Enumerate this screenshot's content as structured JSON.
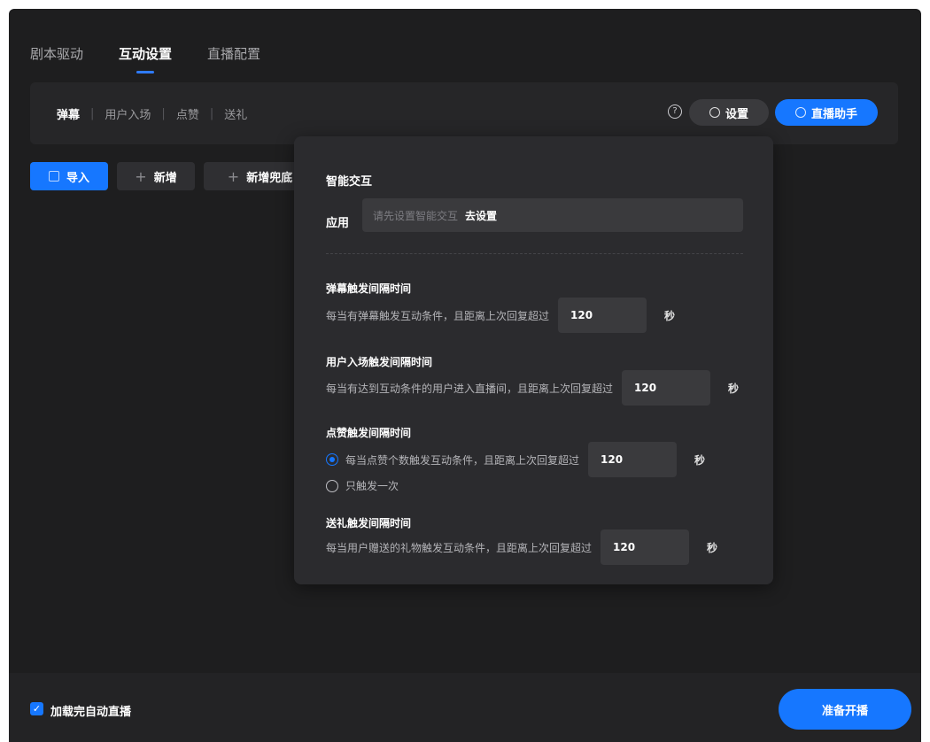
{
  "top_tabs": [
    "剧本驱动",
    "互动设置",
    "直播配置"
  ],
  "sub_tabs": [
    "弹幕",
    "用户入场",
    "点赞",
    "送礼"
  ],
  "header_buttons": {
    "settings": "设置",
    "assistant": "直播助手",
    "help": "?"
  },
  "actions": {
    "import": "导入",
    "add": "新增",
    "add_end": "新增兜底（"
  },
  "panel": {
    "title": "智能交互",
    "apply_label": "应用",
    "apply_placeholder": "请先设置智能交互",
    "apply_link": "去设置",
    "danmu": {
      "title": "弹幕触发间隔时间",
      "desc": "每当有弹幕触发互动条件，且距离上次回复超过",
      "value": "120",
      "unit": "秒"
    },
    "entry": {
      "title": "用户入场触发间隔时间",
      "desc": "每当有达到互动条件的用户进入直播间，且距离上次回复超过",
      "value": "120",
      "unit": "秒"
    },
    "like": {
      "title": "点赞触发间隔时间",
      "option1": "每当点赞个数触发互动条件，且距离上次回复超过",
      "value": "120",
      "unit": "秒",
      "option2": "只触发一次"
    },
    "gift": {
      "title": "送礼触发间隔时间",
      "desc": "每当用户赠送的礼物触发互动条件，且距离上次回复超过",
      "value": "120",
      "unit": "秒"
    }
  },
  "footer": {
    "auto_live_label": "加载完自动直播",
    "auto_live_checked": true,
    "start_button": "准备开播"
  },
  "colors": {
    "accent": "#1677ff",
    "background": "#1e1e1f",
    "panel": "#2b2b2e"
  }
}
